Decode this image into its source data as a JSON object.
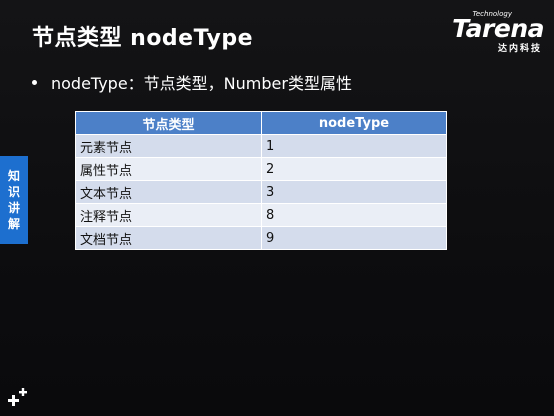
{
  "slide": {
    "title": "节点类型 nodeType",
    "bullet": "nodeType：节点类型，Number类型属性"
  },
  "logo": {
    "tech": "Technology",
    "main": "Tarena",
    "sub": "达内科技"
  },
  "side_tab": {
    "chars": [
      "知",
      "识",
      "讲",
      "解"
    ]
  },
  "table": {
    "headers": [
      "节点类型",
      "nodeType"
    ],
    "rows": [
      [
        "元素节点",
        "1"
      ],
      [
        "属性节点",
        "2"
      ],
      [
        "文本节点",
        "3"
      ],
      [
        "注释节点",
        "8"
      ],
      [
        "文档节点",
        "9"
      ]
    ]
  },
  "colors": {
    "background": "#0f0f10",
    "header": "#4c80c8",
    "row_odd": "#d4dcec",
    "row_even": "#eaeef6",
    "side_tab": "#1d6fcf"
  },
  "icons": {
    "corner": "plus-plus-icon"
  }
}
